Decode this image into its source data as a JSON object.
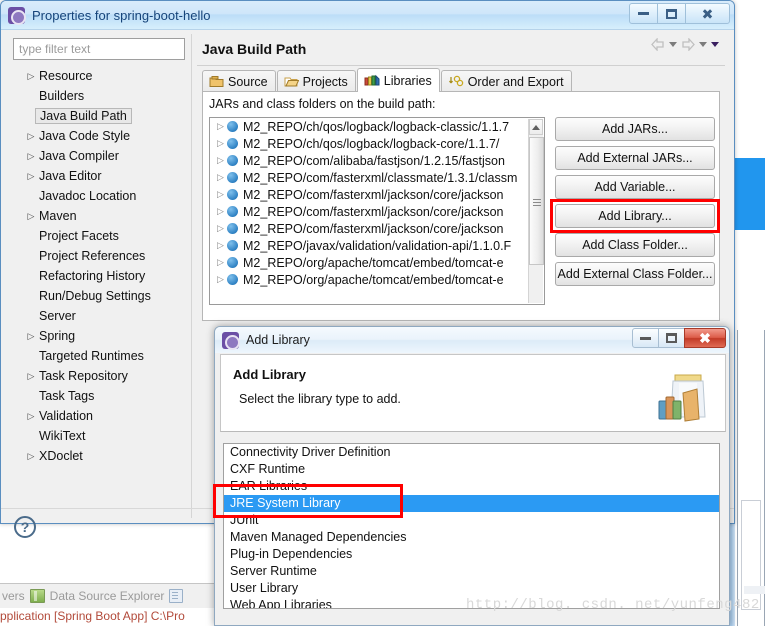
{
  "properties_window": {
    "title": "Properties for spring-boot-hello",
    "app_icon": "eclipse-gear-icon",
    "window_buttons": {
      "minimize": "minimize-icon",
      "maximize": "maximize-icon",
      "close": "close-icon"
    },
    "filter": {
      "placeholder": "type filter text",
      "value": ""
    },
    "tree_items": [
      {
        "label": "Resource",
        "expandable": true,
        "selected": false
      },
      {
        "label": "Builders",
        "expandable": false,
        "selected": false
      },
      {
        "label": "Java Build Path",
        "expandable": false,
        "selected": true
      },
      {
        "label": "Java Code Style",
        "expandable": true,
        "selected": false
      },
      {
        "label": "Java Compiler",
        "expandable": true,
        "selected": false
      },
      {
        "label": "Java Editor",
        "expandable": true,
        "selected": false
      },
      {
        "label": "Javadoc Location",
        "expandable": false,
        "selected": false
      },
      {
        "label": "Maven",
        "expandable": true,
        "selected": false
      },
      {
        "label": "Project Facets",
        "expandable": false,
        "selected": false
      },
      {
        "label": "Project References",
        "expandable": false,
        "selected": false
      },
      {
        "label": "Refactoring History",
        "expandable": false,
        "selected": false
      },
      {
        "label": "Run/Debug Settings",
        "expandable": false,
        "selected": false
      },
      {
        "label": "Server",
        "expandable": false,
        "selected": false
      },
      {
        "label": "Spring",
        "expandable": true,
        "selected": false
      },
      {
        "label": "Targeted Runtimes",
        "expandable": false,
        "selected": false
      },
      {
        "label": "Task Repository",
        "expandable": true,
        "selected": false
      },
      {
        "label": "Task Tags",
        "expandable": false,
        "selected": false
      },
      {
        "label": "Validation",
        "expandable": true,
        "selected": false
      },
      {
        "label": "WikiText",
        "expandable": false,
        "selected": false
      },
      {
        "label": "XDoclet",
        "expandable": true,
        "selected": false
      }
    ],
    "page_title": "Java Build Path",
    "tabs": [
      {
        "label": "Source",
        "icon": "source-folder-icon",
        "active": false
      },
      {
        "label": "Projects",
        "icon": "projects-folder-icon",
        "active": false
      },
      {
        "label": "Libraries",
        "icon": "libraries-books-icon",
        "active": true
      },
      {
        "label": "Order and Export",
        "icon": "order-export-icon",
        "active": false
      }
    ],
    "jars_label": "JARs and class folders on the build path:",
    "jar_entries": [
      "M2_REPO/ch/qos/logback/logback-classic/1.1.7",
      "M2_REPO/ch/qos/logback/logback-core/1.1.7/",
      "M2_REPO/com/alibaba/fastjson/1.2.15/fastjson",
      "M2_REPO/com/fasterxml/classmate/1.3.1/classm",
      "M2_REPO/com/fasterxml/jackson/core/jackson",
      "M2_REPO/com/fasterxml/jackson/core/jackson",
      "M2_REPO/com/fasterxml/jackson/core/jackson",
      "M2_REPO/javax/validation/validation-api/1.1.0.F",
      "M2_REPO/org/apache/tomcat/embed/tomcat-e",
      "M2_REPO/org/apache/tomcat/embed/tomcat-e"
    ],
    "side_buttons": [
      {
        "label": "Add JARs...",
        "highlighted": false
      },
      {
        "label": "Add External JARs...",
        "highlighted": false
      },
      {
        "label": "Add Variable...",
        "highlighted": false
      },
      {
        "label": "Add Library...",
        "highlighted": true
      },
      {
        "label": "Add Class Folder...",
        "highlighted": false
      },
      {
        "label": "Add External Class Folder...",
        "highlighted": false
      }
    ],
    "help_button": "?"
  },
  "add_library_dialog": {
    "title": "Add Library",
    "app_icon": "eclipse-gear-icon",
    "window_buttons": {
      "minimize": "minimize-icon",
      "maximize": "maximize-icon",
      "close": "close-icon"
    },
    "heading": "Add Library",
    "subheading": "Select the library type to add.",
    "banner_icon": "jar-with-books-icon",
    "library_types": [
      {
        "label": "Connectivity Driver Definition",
        "selected": false
      },
      {
        "label": "CXF Runtime",
        "selected": false
      },
      {
        "label": "EAR Libraries",
        "selected": false
      },
      {
        "label": "JRE System Library",
        "selected": true
      },
      {
        "label": "JUnit",
        "selected": false
      },
      {
        "label": "Maven Managed Dependencies",
        "selected": false
      },
      {
        "label": "Plug-in Dependencies",
        "selected": false
      },
      {
        "label": "Server Runtime",
        "selected": false
      },
      {
        "label": "User Library",
        "selected": false
      },
      {
        "label": "Web App Libraries",
        "selected": false
      }
    ]
  },
  "background": {
    "status_tab_partial": "vers",
    "status_tab": "Data Source Explorer",
    "status_icon_1": "data-source-explorer-icon",
    "status_icon_2": "snippets-icon",
    "console_line": "pplication [Spring Boot App] C:\\Pro",
    "watermark": "http://blog. csdn. net/yunfeng482"
  },
  "colors": {
    "highlight_red": "#ff0000",
    "selection_blue": "#2b9af3",
    "title_blue": "#16447a",
    "accent_blue": "#2196ee"
  }
}
